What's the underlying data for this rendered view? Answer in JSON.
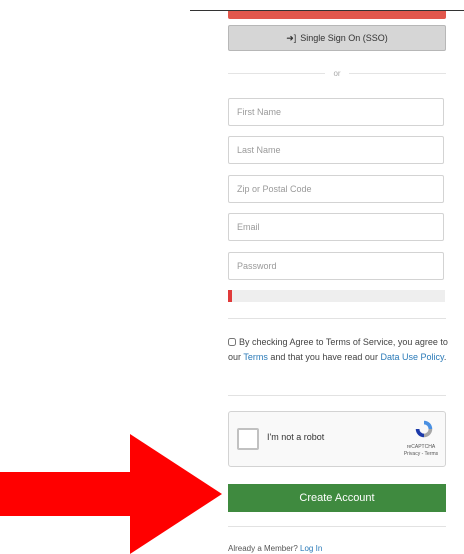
{
  "sso_button": {
    "icon": "sign-in-icon",
    "label": "Single Sign On (SSO)"
  },
  "or_text": "or",
  "fields": {
    "first_name": {
      "placeholder": "First Name",
      "value": ""
    },
    "last_name": {
      "placeholder": "Last Name",
      "value": ""
    },
    "zip": {
      "placeholder": "Zip or Postal Code",
      "value": ""
    },
    "email": {
      "placeholder": "Email",
      "value": ""
    },
    "password": {
      "placeholder": "Password",
      "value": ""
    }
  },
  "password_strength": {
    "fraction": 0.01,
    "color": "#e03a3a"
  },
  "terms": {
    "checked": false,
    "prefix": "By checking Agree to Terms of Service, you agree to our ",
    "terms_link": "Terms",
    "middle": " and that you have read our ",
    "policy_link": "Data Use Policy",
    "suffix": "."
  },
  "recaptcha": {
    "label": "I'm not a robot",
    "brand": "reCAPTCHA",
    "links": "Privacy - Terms"
  },
  "create_button": {
    "label": "Create Account",
    "color": "#3f8a3f"
  },
  "already_member": {
    "text": "Already a Member? ",
    "link": "Log In"
  },
  "annotation": {
    "arrow_color": "#ff0000"
  },
  "colors": {
    "accent_red": "#e2574c",
    "link": "#2a7ab8"
  }
}
